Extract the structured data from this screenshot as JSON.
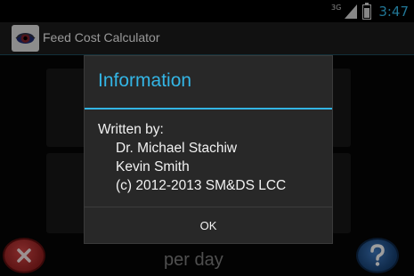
{
  "status_bar": {
    "network": "3G",
    "time": "3:47"
  },
  "action_bar": {
    "title": "Feed Cost Calculator",
    "app_icon": "eye-app-icon"
  },
  "background": {
    "per_day_label": "per day",
    "close_icon": "x-close-icon",
    "help_icon": "question-mark-icon"
  },
  "dialog": {
    "title": "Information",
    "written_by": "Written by:",
    "author_1": "Dr. Michael Stachiw",
    "author_2": "Kevin Smith",
    "copyright": "(c) 2012-2013 SM&DS LCC",
    "ok_label": "OK"
  },
  "colors": {
    "accent": "#33b5e5",
    "dialog_bg": "#282828",
    "close_red": "#c44444",
    "help_blue": "#3b74b8"
  }
}
